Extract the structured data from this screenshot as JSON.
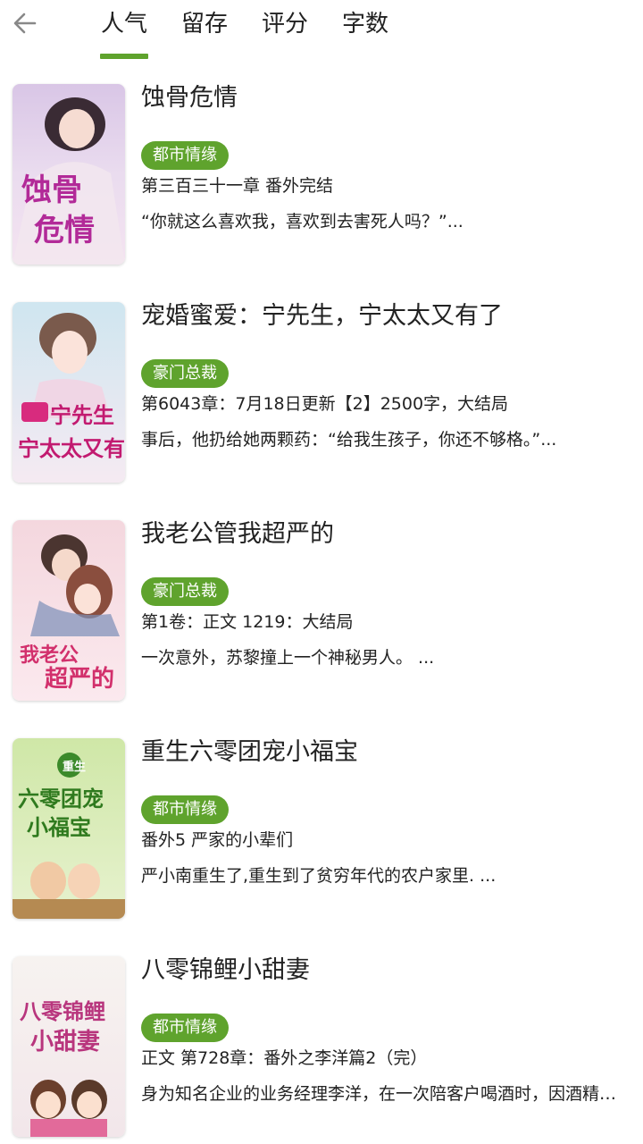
{
  "header": {
    "tabs": [
      {
        "label": "人气",
        "active": true
      },
      {
        "label": "留存",
        "active": false
      },
      {
        "label": "评分",
        "active": false
      },
      {
        "label": "字数",
        "active": false
      }
    ],
    "accent_color": "#5fa32d"
  },
  "books": [
    {
      "title": "蚀骨危情",
      "tag": "都市情缘",
      "chapter": "第三百三十一章 番外完结",
      "desc": "“你就这么喜欢我，喜欢到去害死人吗？”...",
      "cover_text": "蚀骨危情"
    },
    {
      "title": "宠婚蜜爱：宁先生，宁太太又有了",
      "tag": "豪门总裁",
      "chapter": "第6043章：7月18日更新【2】2500字，大结局",
      "desc": "事后，他扔给她两颗药：“给我生孩子，你还不够格。”...",
      "cover_text": "宁先生宁太太又有了"
    },
    {
      "title": "我老公管我超严的",
      "tag": "豪门总裁",
      "chapter": "第1卷：正文 1219：大结局",
      "desc": "一次意外，苏黎撞上一个神秘男人。 ...",
      "cover_text": "我老公超严的"
    },
    {
      "title": "重生六零团宠小福宝",
      "tag": "都市情缘",
      "chapter": "番外5 严家的小辈们",
      "desc": "严小南重生了,重生到了贫穷年代的农户家里. ...",
      "cover_text": "重生六零团宠小福宝"
    },
    {
      "title": "八零锦鲤小甜妻",
      "tag": "都市情缘",
      "chapter": "正文 第728章：番外之李洋篇2（完）",
      "desc": "身为知名企业的业务经理李洋，在一次陪客户喝酒时，因酒精摄...",
      "cover_text": "八零锦鲤小甜妻"
    }
  ]
}
